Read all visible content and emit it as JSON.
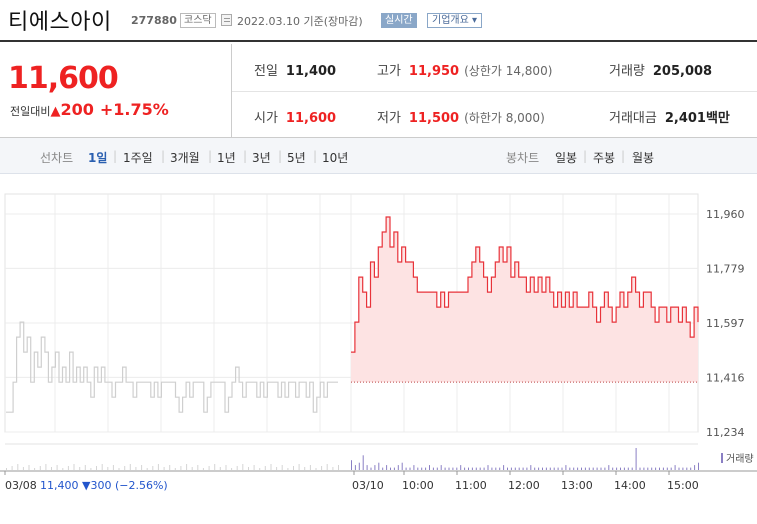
{
  "header": {
    "company_name": "티에스아이",
    "stock_code": "277880",
    "market": "코스닥",
    "date_text": "2022.03.10 기준(장마감)",
    "realtime_label": "실시간",
    "overview_label": "기업개요 ▾"
  },
  "summary": {
    "current_price": "11,600",
    "change_label": "전일대비",
    "change_arrow": "▲",
    "change_value": "200",
    "change_percent": "+1.75%",
    "stats": {
      "prev_close": {
        "label": "전일",
        "value": "11,400"
      },
      "high": {
        "label": "고가",
        "value": "11,950",
        "sub": "(상한가 14,800)"
      },
      "volume": {
        "label": "거래량",
        "value": "205,008"
      },
      "open": {
        "label": "시가",
        "value": "11,600"
      },
      "low": {
        "label": "저가",
        "value": "11,500",
        "sub": "(하한가 8,000)"
      },
      "amount": {
        "label": "거래대금",
        "value": "2,401",
        "unit": "백만"
      }
    }
  },
  "period_bar": {
    "line_chart_label": "선차트",
    "line_periods": [
      "1일",
      "1주일",
      "3개월",
      "1년",
      "3년",
      "5년",
      "10년"
    ],
    "active_period": "1일",
    "candle_chart_label": "봉차트",
    "candle_periods": [
      "일봉",
      "주봉",
      "월봉"
    ]
  },
  "colors": {
    "up": "#e22222",
    "down": "#2255cc",
    "active_tab": "#2a5fb0",
    "today_line": "#e8333a",
    "today_fill": "#fde3e3",
    "prev_line": "#cfcfcf"
  },
  "chart_data": {
    "type": "line",
    "y_ticks": [
      "11,960",
      "11,779",
      "11,597",
      "11,416",
      "11,234"
    ],
    "ylim": [
      11234,
      11960
    ],
    "x_ticks": [
      "03/08",
      "03/10",
      "10:00",
      "11:00",
      "12:00",
      "13:00",
      "14:00",
      "15:00"
    ],
    "volume_label": "거래량",
    "prev_day_note": {
      "date": "03/08",
      "price": "11,400",
      "arrow": "▼",
      "change": "300",
      "percent": "(−2.56%)"
    },
    "reference_price": 11400,
    "series": [
      {
        "values": [
          11300,
          11300,
          11400,
          11550,
          11600,
          11500,
          11550,
          11400,
          11500,
          11450,
          11550,
          11500,
          11400,
          11450,
          11500,
          11400,
          11450,
          11400,
          11500,
          11400,
          11450,
          11400,
          11450,
          11400,
          11350,
          11450,
          11400,
          11450,
          11400,
          11400,
          11350,
          11400,
          11400,
          11450,
          11400,
          11400,
          11350,
          11400,
          11400,
          11400,
          11400,
          11350,
          11400,
          11350,
          11400,
          11400,
          11400,
          11400,
          11350,
          11300,
          11350,
          11400,
          11350,
          11400,
          11400,
          11400,
          11300,
          11350,
          11400,
          11400,
          11400,
          11400,
          11300,
          11350,
          11400,
          11450,
          11400,
          11350,
          11400,
          11400,
          11400,
          11350,
          11400,
          11350,
          11400,
          11400,
          11400,
          11350,
          11400,
          11350,
          11400,
          11400,
          11350,
          11400,
          11400,
          11350,
          11400,
          11300,
          11350,
          11400,
          11350,
          11400,
          11400,
          11400,
          11400
        ]
      },
      {
        "values": [
          11500,
          11600,
          11750,
          11700,
          11650,
          11800,
          11750,
          11850,
          11900,
          11950,
          11850,
          11900,
          11800,
          11850,
          11800,
          11800,
          11750,
          11700,
          11700,
          11700,
          11700,
          11700,
          11650,
          11700,
          11650,
          11700,
          11700,
          11700,
          11700,
          11700,
          11750,
          11800,
          11850,
          11800,
          11750,
          11700,
          11750,
          11800,
          11850,
          11800,
          11850,
          11750,
          11800,
          11750,
          11750,
          11700,
          11750,
          11700,
          11750,
          11700,
          11750,
          11700,
          11650,
          11700,
          11650,
          11700,
          11650,
          11700,
          11650,
          11650,
          11650,
          11700,
          11650,
          11600,
          11650,
          11700,
          11650,
          11600,
          11650,
          11700,
          11650,
          11700,
          11750,
          11700,
          11650,
          11700,
          11700,
          11650,
          11600,
          11650,
          11650,
          11600,
          11650,
          11650,
          11600,
          11650,
          11600,
          11550,
          11650,
          11600
        ]
      }
    ],
    "volume": [
      4,
      2,
      3,
      6,
      2,
      1,
      2,
      3,
      1,
      2,
      1,
      1,
      2,
      3,
      1,
      1,
      2,
      1,
      1,
      1,
      2,
      1,
      1,
      2,
      1,
      1,
      1,
      1,
      2,
      1,
      1,
      1,
      1,
      1,
      1,
      2,
      1,
      1,
      1,
      2,
      1,
      1,
      1,
      1,
      1,
      1,
      2,
      1,
      1,
      1,
      1,
      1,
      1,
      1,
      1,
      2,
      1,
      1,
      1,
      1,
      1,
      1,
      1,
      1,
      1,
      1,
      2,
      1,
      1,
      1,
      1,
      1,
      1,
      9,
      1,
      1,
      1,
      1,
      1,
      1,
      1,
      1,
      1,
      2,
      1,
      1,
      1,
      1,
      2,
      3
    ]
  }
}
